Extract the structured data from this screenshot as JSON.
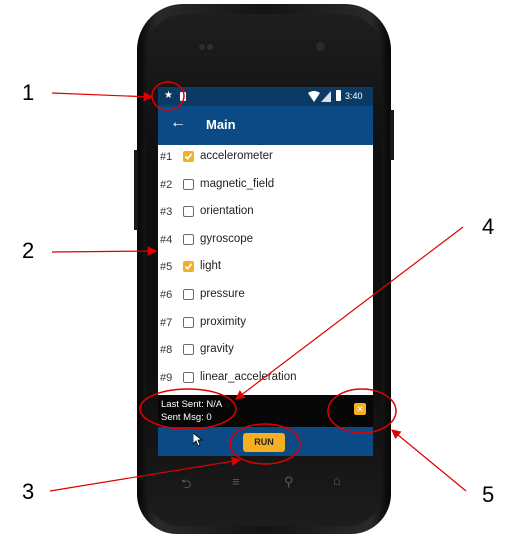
{
  "status_bar": {
    "time": "3:40"
  },
  "app_bar": {
    "title": "Main",
    "back_icon": "arrow-left-icon"
  },
  "sensors": [
    {
      "num": "#1",
      "label": "accelerometer",
      "checked": true
    },
    {
      "num": "#2",
      "label": "magnetic_field",
      "checked": false
    },
    {
      "num": "#3",
      "label": "orientation",
      "checked": false
    },
    {
      "num": "#4",
      "label": "gyroscope",
      "checked": false
    },
    {
      "num": "#5",
      "label": "light",
      "checked": true
    },
    {
      "num": "#6",
      "label": "pressure",
      "checked": false
    },
    {
      "num": "#7",
      "label": "proximity",
      "checked": false
    },
    {
      "num": "#8",
      "label": "gravity",
      "checked": false
    },
    {
      "num": "#9",
      "label": "linear_acceleration",
      "checked": false
    }
  ],
  "info": {
    "last_sent": "Last Sent: N/A",
    "sent_msg": "Sent Msg: 0"
  },
  "run_button": "RUN",
  "callouts": [
    "1",
    "2",
    "3",
    "4",
    "5"
  ],
  "colors": {
    "accent": "#f4b021",
    "app_bar": "#0b4a85",
    "status_bar": "#0b3b65",
    "annotation": "#e00000"
  }
}
